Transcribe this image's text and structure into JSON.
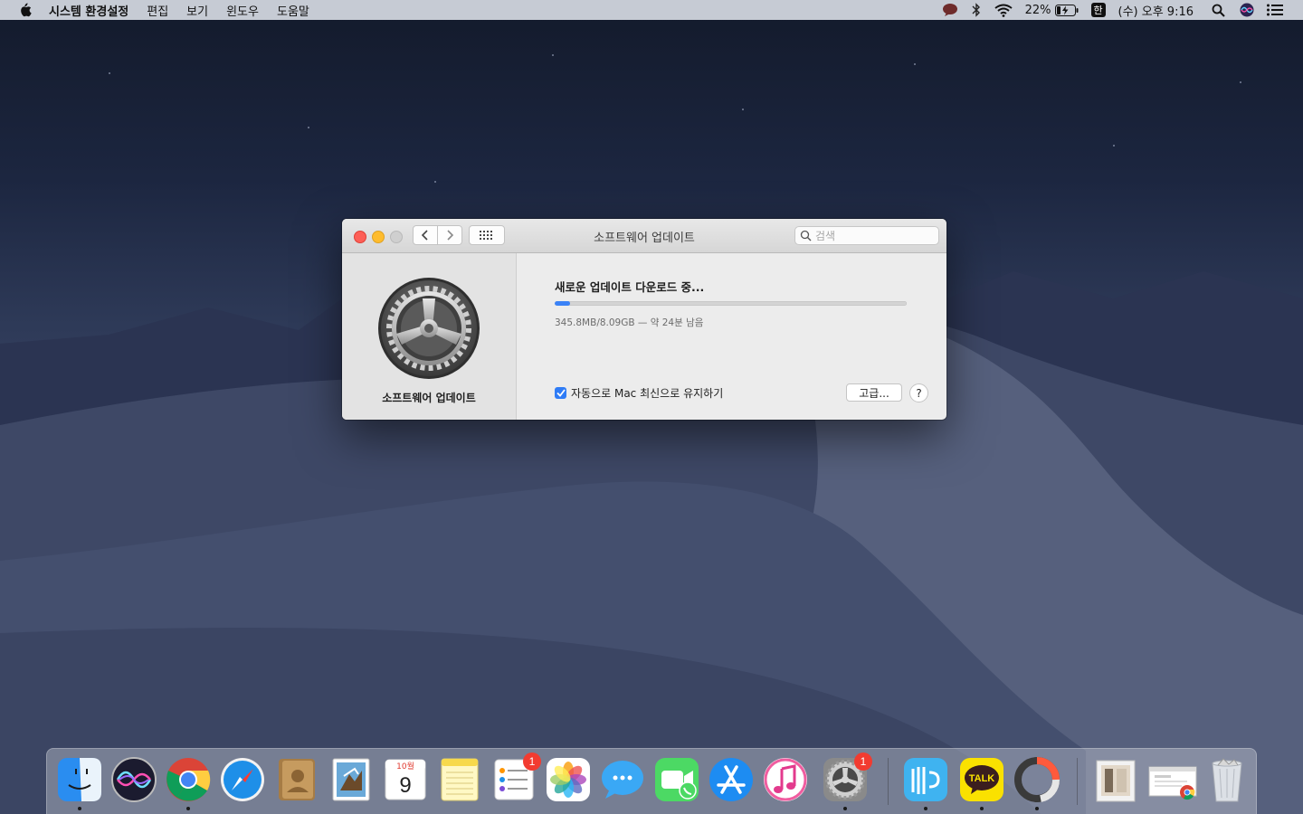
{
  "menubar": {
    "app_name": "시스템 환경설정",
    "menus": [
      "편집",
      "보기",
      "윈도우",
      "도움말"
    ],
    "battery_percent": "22%",
    "input_source": "한",
    "clock": "(수) 오후 9:16"
  },
  "window": {
    "title": "소프트웨어 업데이트",
    "search_placeholder": "검색",
    "sidebar_label": "소프트웨어 업데이트",
    "heading": "새로운 업데이트 다운로드 중...",
    "progress_fraction": 0.0427,
    "status": "345.8MB/8.09GB — 약 24분 남음",
    "auto_update_label": "자동으로 Mac 최신으로 유지하기",
    "auto_update_checked": true,
    "advanced_button": "고급...",
    "help_button": "?"
  },
  "dock": {
    "apps": [
      {
        "name": "Finder",
        "running": true
      },
      {
        "name": "Siri",
        "running": false
      },
      {
        "name": "Chrome",
        "running": true
      },
      {
        "name": "Safari",
        "running": false
      },
      {
        "name": "Contacts",
        "running": false
      },
      {
        "name": "Mail",
        "running": false
      },
      {
        "name": "Calendar",
        "running": false,
        "month": "10월",
        "day": "9"
      },
      {
        "name": "Notes",
        "running": false
      },
      {
        "name": "Reminders",
        "running": false,
        "badge": "1"
      },
      {
        "name": "Photos",
        "running": false
      },
      {
        "name": "Messages",
        "running": false
      },
      {
        "name": "FaceTime",
        "running": false
      },
      {
        "name": "App Store",
        "running": false
      },
      {
        "name": "iTunes",
        "running": false
      },
      {
        "name": "System Preferences",
        "running": true,
        "badge": "1"
      },
      {
        "name": "Weverse",
        "running": true
      },
      {
        "name": "KakaoTalk",
        "running": true,
        "label": "TALK"
      },
      {
        "name": "Arc App",
        "running": true
      },
      {
        "name": "Document Stack",
        "running": false
      },
      {
        "name": "Chrome Window",
        "running": false
      },
      {
        "name": "Trash",
        "running": false
      }
    ]
  },
  "colors": {
    "accent": "#3a82f7",
    "menubar_bg": "#c6cbd4",
    "badge": "#f23b30"
  }
}
